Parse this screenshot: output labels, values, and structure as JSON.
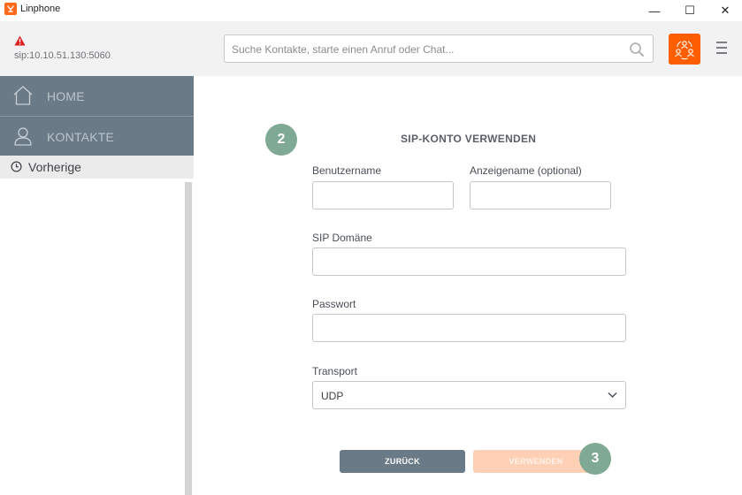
{
  "window": {
    "title": "Linphone",
    "minimize_glyph": "—",
    "maximize_glyph": "☐",
    "close_glyph": "✕"
  },
  "header": {
    "sip_address": "sip:10.10.51.130:5060",
    "status_icon": "warning-icon",
    "search_placeholder": "Suche Kontakte, starte einen Anruf oder Chat...",
    "search_value": ""
  },
  "sidebar": {
    "items": [
      {
        "label": "HOME",
        "icon": "home-icon"
      },
      {
        "label": "KONTAKTE",
        "icon": "contact-icon"
      }
    ],
    "recent_label": "Vorherige"
  },
  "form": {
    "step_number": "2",
    "title": "SIP-KONTO VERWENDEN",
    "username_label": "Benutzername",
    "username_value": "",
    "display_name_label": "Anzeigename (optional)",
    "display_name_value": "",
    "domain_label": "SIP Domäne",
    "domain_value": "",
    "password_label": "Passwort",
    "password_value": "",
    "transport_label": "Transport",
    "transport_value": "UDP",
    "back_label": "ZURÜCK",
    "use_label": "VERWENDEN",
    "use_step_number": "3"
  },
  "colors": {
    "accent": "#fe5e00",
    "nav": "#6a7a86",
    "step_badge": "#7fa995",
    "disabled_button": "#ffd0b5"
  }
}
